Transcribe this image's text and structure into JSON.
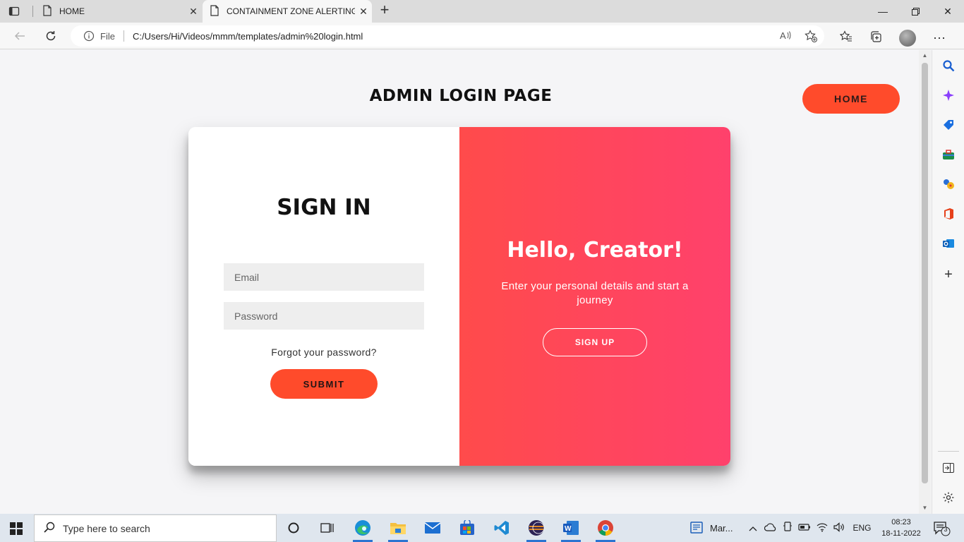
{
  "browser": {
    "tabs": [
      {
        "title": "HOME",
        "active": false
      },
      {
        "title": "CONTAINMENT ZONE ALERTING",
        "active": true
      }
    ],
    "address": {
      "info_label": "File",
      "url": "C:/Users/Hi/Videos/mmm/templates/admin%20login.html"
    }
  },
  "page": {
    "title": "ADMIN LOGIN PAGE",
    "home_button": "HOME",
    "signin": {
      "heading": "SIGN IN",
      "email_placeholder": "Email",
      "password_placeholder": "Password",
      "forgot_link": "Forgot your password?",
      "submit_label": "SUBMIT"
    },
    "overlay": {
      "heading": "Hello, Creator!",
      "text": "Enter your personal details and start a journey",
      "signup_label": "SIGN UP"
    }
  },
  "taskbar": {
    "search_placeholder": "Type here to search",
    "weather_text": "Mar...",
    "language": "ENG",
    "time": "08:23",
    "date": "18-11-2022",
    "notification_count": "3"
  },
  "colors": {
    "accent": "#ff4b2b",
    "gradient_start": "#ff4b4b",
    "gradient_end": "#ff416c"
  }
}
